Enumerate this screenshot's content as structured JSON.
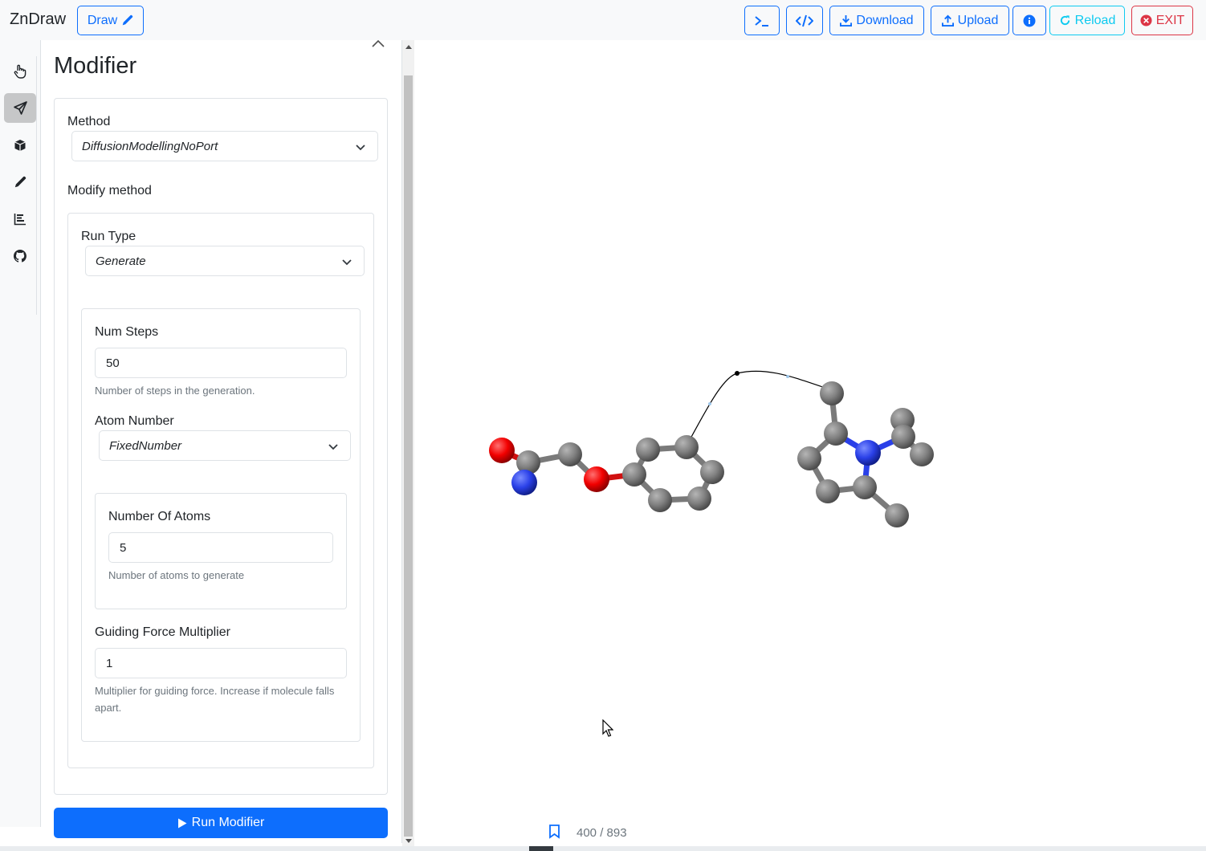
{
  "app": {
    "title": "ZnDraw"
  },
  "toolbar": {
    "draw_label": "Draw",
    "download_label": "Download",
    "upload_label": "Upload",
    "reload_label": "Reload",
    "exit_label": "EXIT",
    "terminal_icon": "terminal-icon",
    "code_icon": "code-icon",
    "info_icon": "info-icon"
  },
  "sidebar": {
    "items": [
      {
        "icon": "hand-pointer-icon",
        "active": false
      },
      {
        "icon": "send-icon",
        "active": true
      },
      {
        "icon": "box-icon",
        "active": false
      },
      {
        "icon": "pencil-icon",
        "active": false
      },
      {
        "icon": "bar-chart-icon",
        "active": false
      },
      {
        "icon": "github-icon",
        "active": false
      }
    ]
  },
  "modifier": {
    "title": "Modifier",
    "method_label": "Method",
    "method_value": "DiffusionModellingNoPort",
    "modify_method_label": "Modify method",
    "run_type_label": "Run Type",
    "run_type_value": "Generate",
    "num_steps_label": "Num Steps",
    "num_steps_value": "50",
    "num_steps_help": "Number of steps in the generation.",
    "atom_number_label": "Atom Number",
    "atom_number_value": "FixedNumber",
    "num_atoms_label": "Number Of Atoms",
    "num_atoms_value": "5",
    "num_atoms_help": "Number of atoms to generate",
    "guiding_label": "Guiding Force Multiplier",
    "guiding_value": "1",
    "guiding_help": "Multiplier for guiding force. Increase if molecule falls apart.",
    "run_button_label": "Run Modifier"
  },
  "viewer": {
    "frame_counter": "400 / 893",
    "atom_colors": {
      "carbon": "#808080",
      "oxygen": "#ff0d0d",
      "nitrogen": "#2a40e8"
    }
  }
}
